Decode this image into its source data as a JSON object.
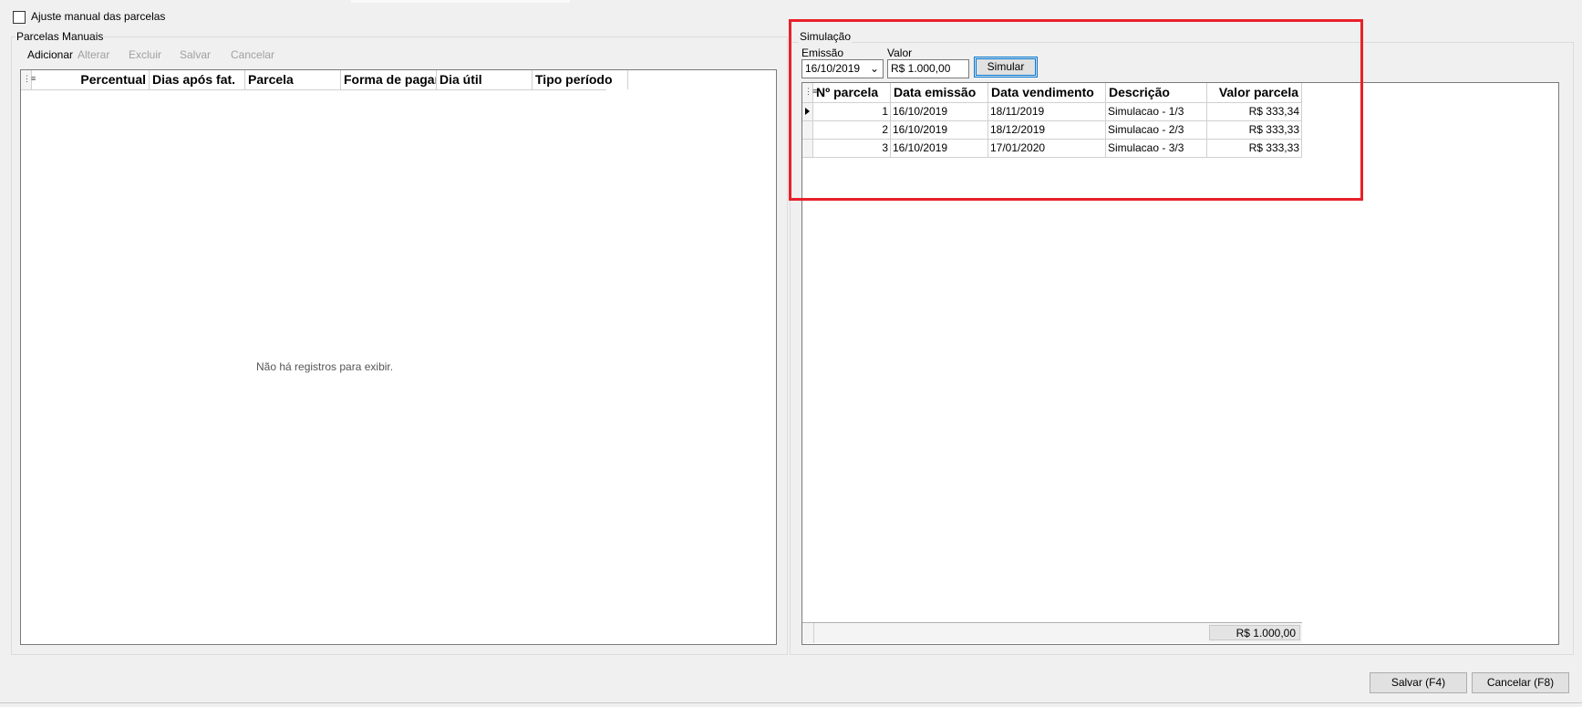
{
  "manual_adjust": {
    "label": "Ajuste manual das parcelas",
    "checked": false
  },
  "manual_group": {
    "title": "Parcelas Manuais",
    "toolbar": {
      "add": "Adicionar",
      "edit": "Alterar",
      "delete": "Excluir",
      "save": "Salvar",
      "cancel": "Cancelar"
    },
    "columns": [
      "Percentual",
      "Dias após fat.",
      "Parcela",
      "Forma de pagar",
      "Dia útil",
      "Tipo período"
    ],
    "empty_message": "Não há registros para exibir."
  },
  "simulation": {
    "title": "Simulação",
    "emission_label": "Emissão",
    "emission_value": "16/10/2019",
    "value_label": "Valor",
    "value_value": "R$ 1.000,00",
    "simulate_button": "Simular",
    "columns": [
      "Nº parcela",
      "Data emissão",
      "Data vendimento",
      "Descrição",
      "Valor parcela"
    ],
    "rows": [
      {
        "num": "1",
        "emission": "16/10/2019",
        "due": "18/11/2019",
        "desc": "Simulacao - 1/3",
        "value": "R$ 333,34",
        "current": true
      },
      {
        "num": "2",
        "emission": "16/10/2019",
        "due": "18/12/2019",
        "desc": "Simulacao - 2/3",
        "value": "R$ 333,33",
        "current": false
      },
      {
        "num": "3",
        "emission": "16/10/2019",
        "due": "17/01/2020",
        "desc": "Simulacao - 3/3",
        "value": "R$ 333,33",
        "current": false
      }
    ],
    "total": "R$ 1.000,00"
  },
  "footer": {
    "save_button": "Salvar (F4)",
    "cancel_button": "Cancelar (F8)"
  },
  "colors": {
    "highlight": "#e8202a",
    "focus": "#0078d7"
  }
}
